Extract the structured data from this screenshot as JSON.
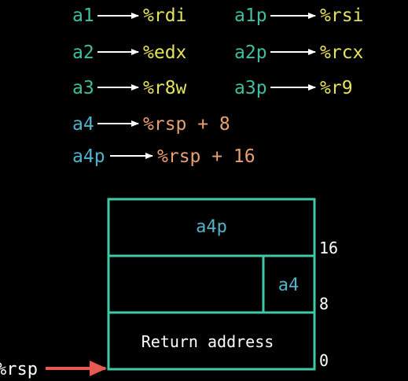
{
  "colors": {
    "background": "#000000",
    "arg_var": "#3fbfa0",
    "register": "#e6e35a",
    "stack_ref": "#e8a070",
    "mem_var": "#4fb3c9",
    "box": "#3ec9a7",
    "arrow_red": "#e85a4f",
    "text": "#ffffff"
  },
  "mappings": [
    {
      "var": "a1",
      "reg": "%rdi",
      "var_kind": "arg",
      "reg_kind": "register"
    },
    {
      "var": "a1p",
      "reg": "%rsi",
      "var_kind": "arg",
      "reg_kind": "register"
    },
    {
      "var": "a2",
      "reg": "%edx",
      "var_kind": "arg",
      "reg_kind": "register"
    },
    {
      "var": "a2p",
      "reg": "%rcx",
      "var_kind": "arg",
      "reg_kind": "register"
    },
    {
      "var": "a3",
      "reg": "%r8w",
      "var_kind": "arg",
      "reg_kind": "register"
    },
    {
      "var": "a3p",
      "reg": "%r9",
      "var_kind": "arg",
      "reg_kind": "register"
    },
    {
      "var": "a4",
      "reg": "%rsp + 8",
      "var_kind": "mem",
      "reg_kind": "stack"
    },
    {
      "var": "a4p",
      "reg": "%rsp + 16",
      "var_kind": "mem",
      "reg_kind": "stack"
    }
  ],
  "stack": {
    "top_cell": "a4p",
    "middle_right_cell": "a4",
    "bottom_cell": "Return address",
    "offsets": [
      "16",
      "8",
      "0"
    ],
    "pointer_label": "%rsp"
  }
}
